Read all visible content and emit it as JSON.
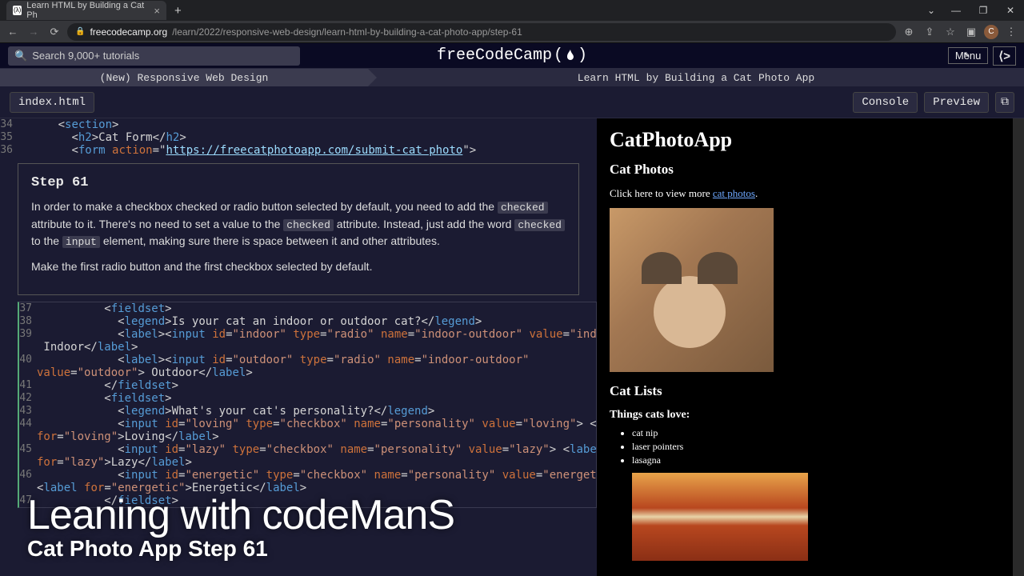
{
  "browser": {
    "tab_title": "Learn HTML by Building a Cat Ph",
    "url_domain": "freecodecamp.org",
    "url_path": "/learn/2022/responsive-web-design/learn-html-by-building-a-cat-photo-app/step-61",
    "avatar_letter": "C"
  },
  "header": {
    "search_placeholder": "Search 9,000+ tutorials",
    "brand": "freeCodeCamp",
    "menu": "Menu"
  },
  "crumbs": {
    "left": "(New) Responsive Web Design",
    "right": "Learn HTML by Building a Cat Photo App"
  },
  "toolbar": {
    "file": "index.html",
    "console": "Console",
    "preview": "Preview"
  },
  "editor_top": [
    {
      "n": "34",
      "html": "      <span class='t-txt'>&lt;</span><span class='t-tag'>section</span><span class='t-txt'>&gt;</span>"
    },
    {
      "n": "35",
      "html": "        <span class='t-txt'>&lt;</span><span class='t-tag'>h2</span><span class='t-txt'>&gt;Cat Form&lt;/</span><span class='t-tag'>h2</span><span class='t-txt'>&gt;</span>"
    },
    {
      "n": "36",
      "html": "        <span class='t-txt'>&lt;</span><span class='t-tag'>form</span> <span class='t-attr'>action</span><span class='t-txt'>=&quot;</span><span class='t-url'>https://freecatphotoapp.com/submit-cat-photo</span><span class='t-txt'>&quot;&gt;</span>"
    }
  ],
  "instruction": {
    "title": "Step 61",
    "p1a": "In order to make a checkbox checked or radio button selected by default, you need to add the ",
    "k1": "checked",
    "p1b": " attribute to it. There's no need to set a value to the ",
    "k2": "checked",
    "p1c": " attribute. Instead, just add the word ",
    "k3": "checked",
    "p1d": " to the ",
    "k4": "input",
    "p1e": " element, making sure there is space between it and other attributes.",
    "p2": "Make the first radio button and the first checkbox selected by default."
  },
  "editor_bot": [
    {
      "n": "37",
      "html": "          <span class='t-txt'>&lt;</span><span class='t-tag'>fieldset</span><span class='t-txt'>&gt;</span>"
    },
    {
      "n": "38",
      "html": "            <span class='t-txt'>&lt;</span><span class='t-tag'>legend</span><span class='t-txt'>&gt;Is your cat an indoor or outdoor cat?&lt;/</span><span class='t-tag'>legend</span><span class='t-txt'>&gt;</span>"
    },
    {
      "n": "39",
      "html": "            <span class='t-txt'>&lt;</span><span class='t-tag'>label</span><span class='t-txt'>&gt;&lt;</span><span class='t-tag'>input</span> <span class='t-attr'>id</span><span class='t-txt'>=</span><span class='t-str'>&quot;indoor&quot;</span> <span class='t-attr'>type</span><span class='t-txt'>=</span><span class='t-str'>&quot;radio&quot;</span> <span class='t-attr'>name</span><span class='t-txt'>=</span><span class='t-str'>&quot;indoor-outdoor&quot;</span> <span class='t-attr'>value</span><span class='t-txt'>=</span><span class='t-str'>&quot;indoor&quot;</span><span class='t-txt'>&gt;</span>"
    },
    {
      "n": "",
      "html": "<span class='t-txt'> Indoor&lt;/</span><span class='t-tag'>label</span><span class='t-txt'>&gt;</span>"
    },
    {
      "n": "40",
      "html": "            <span class='t-txt'>&lt;</span><span class='t-tag'>label</span><span class='t-txt'>&gt;&lt;</span><span class='t-tag'>input</span> <span class='t-attr'>id</span><span class='t-txt'>=</span><span class='t-str'>&quot;outdoor&quot;</span> <span class='t-attr'>type</span><span class='t-txt'>=</span><span class='t-str'>&quot;radio&quot;</span> <span class='t-attr'>name</span><span class='t-txt'>=</span><span class='t-str'>&quot;indoor-outdoor&quot;</span>"
    },
    {
      "n": "",
      "html": "<span class='t-attr'>value</span><span class='t-txt'>=</span><span class='t-str'>&quot;outdoor&quot;</span><span class='t-txt'>&gt; Outdoor&lt;/</span><span class='t-tag'>label</span><span class='t-txt'>&gt;</span>"
    },
    {
      "n": "41",
      "html": "          <span class='t-txt'>&lt;/</span><span class='t-tag'>fieldset</span><span class='t-txt'>&gt;</span>"
    },
    {
      "n": "42",
      "html": "          <span class='t-txt'>&lt;</span><span class='t-tag'>fieldset</span><span class='t-txt'>&gt;</span>"
    },
    {
      "n": "43",
      "html": "            <span class='t-txt'>&lt;</span><span class='t-tag'>legend</span><span class='t-txt'>&gt;What's your cat's personality?&lt;/</span><span class='t-tag'>legend</span><span class='t-txt'>&gt;</span>"
    },
    {
      "n": "44",
      "html": "            <span class='t-txt'>&lt;</span><span class='t-tag'>input</span> <span class='t-attr'>id</span><span class='t-txt'>=</span><span class='t-str'>&quot;loving&quot;</span> <span class='t-attr'>type</span><span class='t-txt'>=</span><span class='t-str'>&quot;checkbox&quot;</span> <span class='t-attr'>name</span><span class='t-txt'>=</span><span class='t-str'>&quot;personality&quot;</span> <span class='t-attr'>value</span><span class='t-txt'>=</span><span class='t-str'>&quot;loving&quot;</span><span class='t-txt'>&gt; &lt;</span><span class='t-tag'>label</span>"
    },
    {
      "n": "",
      "html": "<span class='t-attr'>for</span><span class='t-txt'>=</span><span class='t-str'>&quot;loving&quot;</span><span class='t-txt'>&gt;Loving&lt;/</span><span class='t-tag'>label</span><span class='t-txt'>&gt;</span>"
    },
    {
      "n": "45",
      "html": "            <span class='t-txt'>&lt;</span><span class='t-tag'>input</span> <span class='t-attr'>id</span><span class='t-txt'>=</span><span class='t-str'>&quot;lazy&quot;</span> <span class='t-attr'>type</span><span class='t-txt'>=</span><span class='t-str'>&quot;checkbox&quot;</span> <span class='t-attr'>name</span><span class='t-txt'>=</span><span class='t-str'>&quot;personality&quot;</span> <span class='t-attr'>value</span><span class='t-txt'>=</span><span class='t-str'>&quot;lazy&quot;</span><span class='t-txt'>&gt; &lt;</span><span class='t-tag'>label</span>"
    },
    {
      "n": "",
      "html": "<span class='t-attr'>for</span><span class='t-txt'>=</span><span class='t-str'>&quot;lazy&quot;</span><span class='t-txt'>&gt;Lazy&lt;/</span><span class='t-tag'>label</span><span class='t-txt'>&gt;</span>"
    },
    {
      "n": "46",
      "html": "            <span class='t-txt'>&lt;</span><span class='t-tag'>input</span> <span class='t-attr'>id</span><span class='t-txt'>=</span><span class='t-str'>&quot;energetic&quot;</span> <span class='t-attr'>type</span><span class='t-txt'>=</span><span class='t-str'>&quot;checkbox&quot;</span> <span class='t-attr'>name</span><span class='t-txt'>=</span><span class='t-str'>&quot;personality&quot;</span> <span class='t-attr'>value</span><span class='t-txt'>=</span><span class='t-str'>&quot;energetic&quot;</span><span class='t-txt'>&gt;</span>"
    },
    {
      "n": "",
      "html": "<span class='t-txt'>&lt;</span><span class='t-tag'>label</span> <span class='t-attr'>for</span><span class='t-txt'>=</span><span class='t-str'>&quot;energetic&quot;</span><span class='t-txt'>&gt;Energetic&lt;/</span><span class='t-tag'>label</span><span class='t-txt'>&gt;</span>"
    },
    {
      "n": "47",
      "html": "          <span class='t-txt'>&lt;/</span><span class='t-tag'>fieldset</span><span class='t-txt'>&gt;</span>"
    }
  ],
  "preview": {
    "h1": "CatPhotoApp",
    "h2a": "Cat Photos",
    "p1a": "Click here to view more ",
    "link": "cat photos",
    "p1b": ".",
    "h2b": "Cat Lists",
    "h3a": "Things cats love:",
    "list": [
      "cat nip",
      "laser pointers",
      "lasagna"
    ]
  },
  "overlay": {
    "big": "Leaning with codeManS",
    "small": "Cat Photo App Step 61"
  }
}
